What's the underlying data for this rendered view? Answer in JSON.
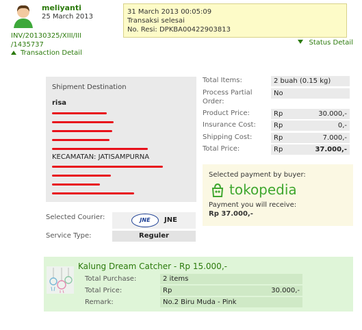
{
  "header": {
    "username": "meliyanti",
    "date": "25 March 2013",
    "invoice": "INV/20130325/XIII/III /1435737",
    "transaction_detail": "Transaction Detail",
    "status_detail": "Status Detail"
  },
  "status": {
    "datetime": "31 March 2013 00:05:09",
    "message": "Transaksi selesai",
    "resi": "No. Resi: DPKBA00422903813"
  },
  "shipment": {
    "title": "Shipment Destination",
    "recipient": "risa",
    "visible_line": "KECAMATAN: JATISAMPURNA"
  },
  "courier": {
    "label": "Selected Courier:",
    "logo_text": "JNE",
    "name": "JNE",
    "service_label": "Service Type:",
    "service": "Reguler"
  },
  "summary": {
    "total_items_label": "Total Items:",
    "total_items": "2 buah (0.15 kg)",
    "partial_label": "Process Partial Order:",
    "partial": "No",
    "product_price_label": "Product Price:",
    "product_price": "30.000,-",
    "insurance_label": "Insurance Cost:",
    "insurance": "0,-",
    "shipping_label": "Shipping Cost:",
    "shipping": "7.000,-",
    "total_label": "Total Price:",
    "total": "37.000,-",
    "currency": "Rp"
  },
  "payment": {
    "selected_label": "Selected payment by buyer:",
    "method": "tokopedia",
    "receive_label": "Payment you will receive:",
    "amount": "Rp 37.000,-"
  },
  "product": {
    "title": "Kalung Dream Catcher - Rp 15.000,-",
    "purchase_label": "Total Purchase:",
    "purchase": "2 items",
    "price_label": "Total Price:",
    "currency": "Rp",
    "price": "30.000,-",
    "remark_label": "Remark:",
    "remark": "No.2 Biru Muda - Pink"
  },
  "colors": {
    "accent_green": "#2b7a0b",
    "status_yellow": "#fdfbc8",
    "redaction_red": "#e8111b",
    "tokopedia_green": "#3fa72f",
    "product_bg": "#dff5d8"
  }
}
